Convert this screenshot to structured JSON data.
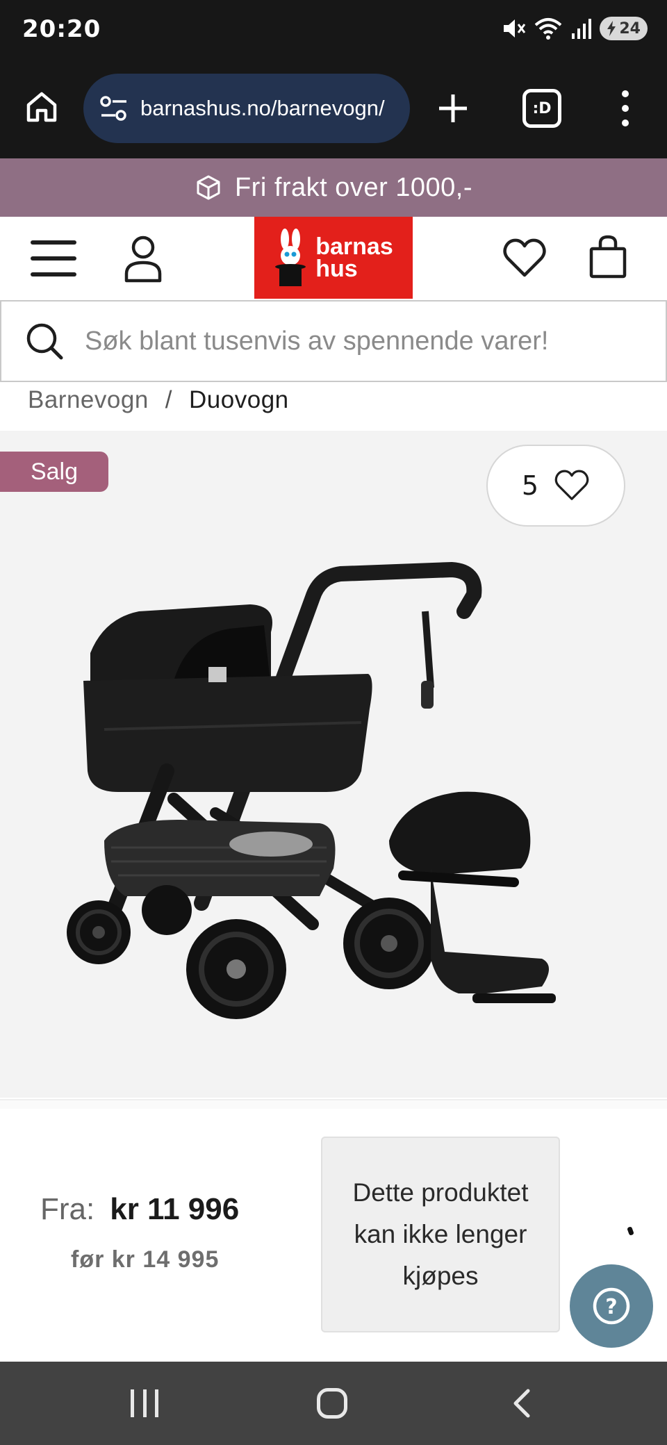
{
  "status_bar": {
    "time": "20:20",
    "battery_level": "24",
    "icons": [
      "mute-icon",
      "wifi-icon",
      "signal-icon",
      "battery-charging-icon"
    ]
  },
  "browser": {
    "url": "barnashus.no/barnevogn/",
    "tabs_label": ":D",
    "icons": [
      "home-icon",
      "site-settings-icon",
      "plus-icon",
      "tabs-icon",
      "more-vert-icon"
    ]
  },
  "promo": {
    "text": "Fri frakt over 1000,-",
    "icon": "package-icon"
  },
  "header": {
    "logo_line1": "barnas",
    "logo_line2": "hus",
    "icons": [
      "menu-icon",
      "account-icon",
      "heart-icon",
      "bag-icon"
    ]
  },
  "search": {
    "placeholder": "Søk blant tusenvis av spennende varer!"
  },
  "breadcrumb": {
    "items": [
      "Barnevogn",
      "Duovogn"
    ],
    "separator": "/"
  },
  "product": {
    "badge": "Salg",
    "favorites_count": "5",
    "price_prefix": "Fra:",
    "price_now": "kr 11 996",
    "price_before": "før kr 14 995",
    "unavailable_text": "Dette produktet kan ikke lenger kjøpes"
  },
  "help": {
    "label": "?"
  },
  "colors": {
    "promo_bg": "#8f6f84",
    "logo_red": "#e3201b",
    "sale_badge": "#a4607b",
    "help_fab": "#5f8598",
    "browser_url_bg": "#233350"
  }
}
